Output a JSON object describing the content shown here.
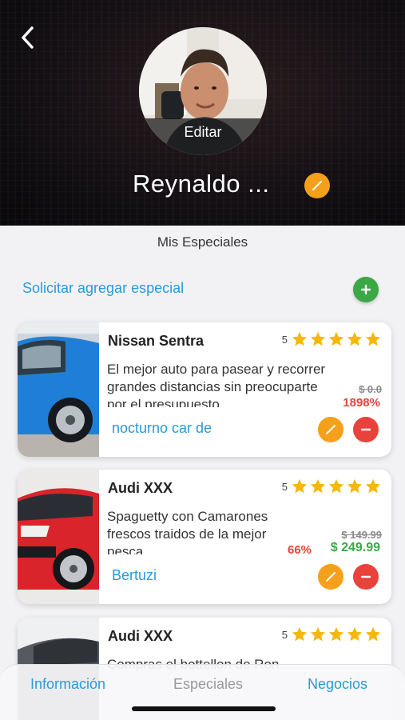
{
  "header": {
    "profile_name": "Reynaldo ...",
    "avatar_edit_label": "Editar"
  },
  "section": {
    "title": "Mis Especiales",
    "request_link": "Solicitar agregar especial"
  },
  "specials": [
    {
      "title": "Nissan Sentra",
      "rating": "5",
      "description": "El mejor auto para pasear y recorrer grandes distancias sin preocuparte por el presupuesto",
      "old_price": "$ 0.0",
      "discount": "1898%",
      "new_price": "",
      "store": "nocturno car de",
      "image_color": "#1f7fd8"
    },
    {
      "title": "Audi XXX",
      "rating": "5",
      "description": "Spaguetty con Camarones frescos traidos de la mejor pesca",
      "old_price": "$ 149.99",
      "discount": "66%",
      "new_price": "$ 249.99",
      "store": "Bertuzi",
      "image_color": "#d8242a"
    },
    {
      "title": "Audi XXX",
      "rating": "5",
      "description": "Compras el bottellon de Ron",
      "image_color": "#555a60"
    }
  ],
  "tabs": {
    "info": "Información",
    "specials": "Especiales",
    "business": "Negocios"
  },
  "colors": {
    "accent_blue": "#2a9ad8",
    "edit_orange": "#f5a01a",
    "delete_red": "#e8423a",
    "add_green": "#3ba845",
    "star_yellow": "#f5b70a"
  }
}
